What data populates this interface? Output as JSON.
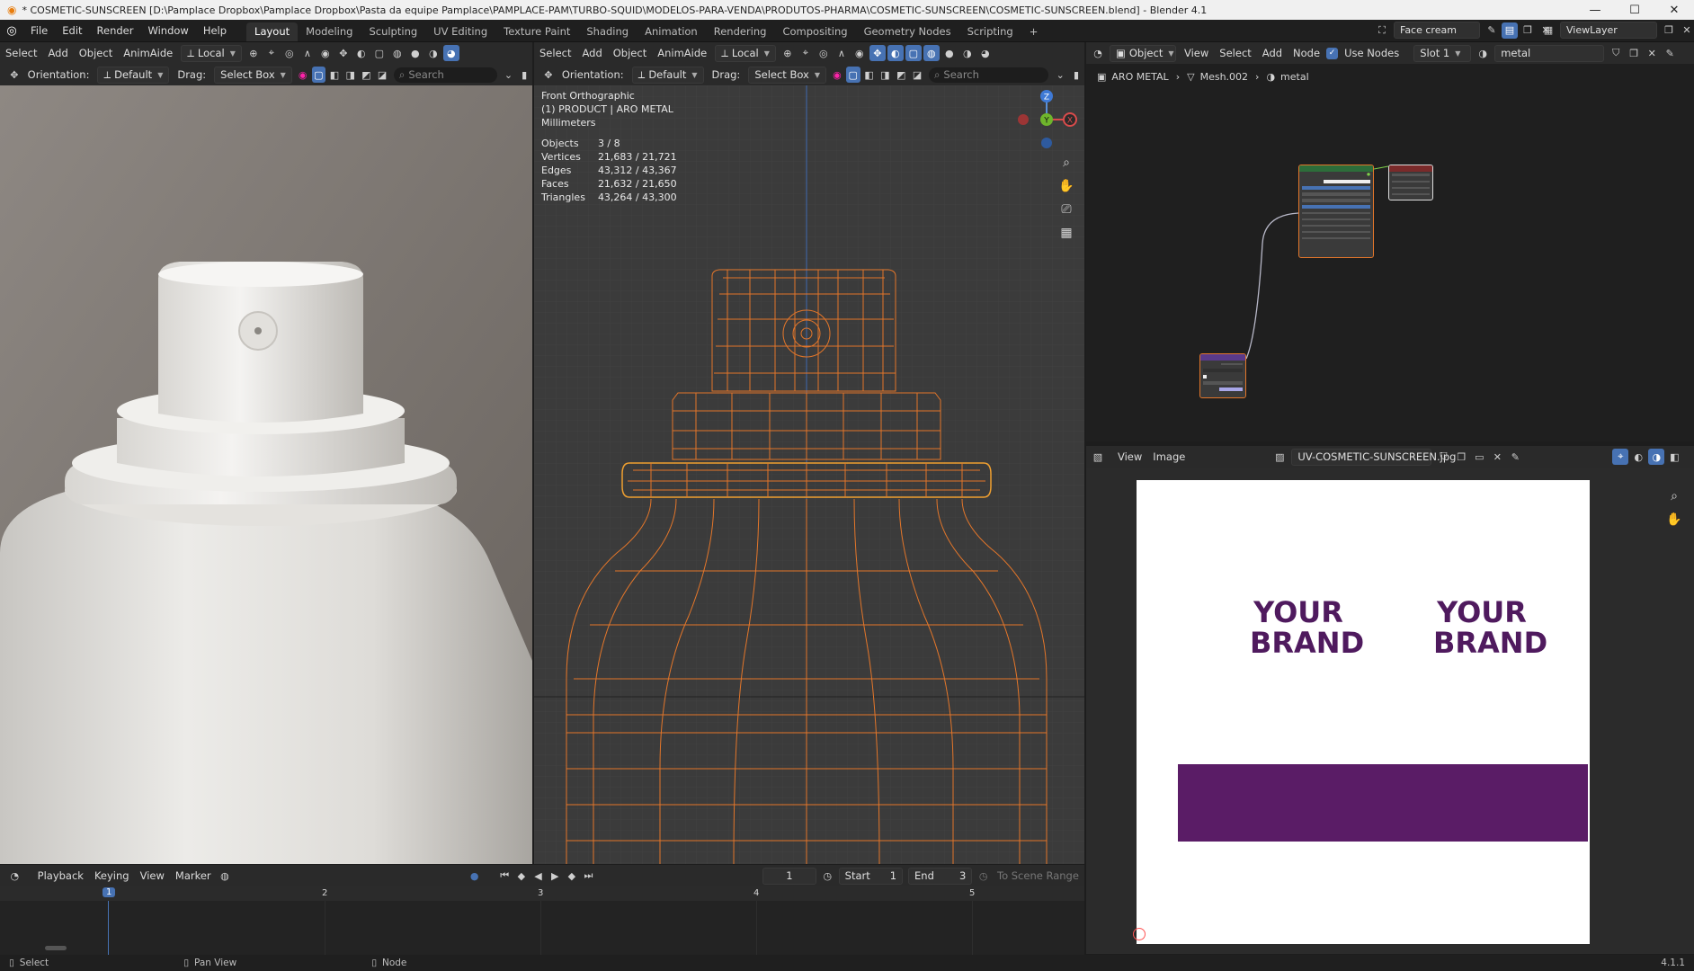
{
  "window": {
    "title": "* COSMETIC-SUNSCREEN [D:\\Pamplace Dropbox\\Pamplace Dropbox\\Pasta da equipe Pamplace\\PAMPLACE-PAM\\TURBO-SQUID\\MODELOS-PARA-VENDA\\PRODUTOS-PHARMA\\COSMETIC-SUNSCREEN\\COSMETIC-SUNSCREEN.blend] - Blender 4.1",
    "minimize": "—",
    "maximize": "☐",
    "close": "✕"
  },
  "menu": [
    "File",
    "Edit",
    "Render",
    "Window",
    "Help"
  ],
  "workspaces": [
    "Layout",
    "Modeling",
    "Sculpting",
    "UV Editing",
    "Texture Paint",
    "Shading",
    "Animation",
    "Rendering",
    "Compositing",
    "Geometry Nodes",
    "Scripting"
  ],
  "active_workspace": "Layout",
  "top_right": {
    "scene_name": "Face cream",
    "view_layer": "ViewLayer"
  },
  "left_viewport": {
    "header_menu": [
      "Select",
      "Add",
      "Object",
      "AnimAide"
    ],
    "transform_orientation": "Local",
    "orientation_label": "Orientation:",
    "orientation_value": "Default",
    "drag_label": "Drag:",
    "drag_value": "Select Box",
    "search_placeholder": "Search"
  },
  "center_viewport": {
    "header_menu": [
      "Select",
      "Add",
      "Object",
      "AnimAide"
    ],
    "transform_orientation": "Local",
    "orientation_label": "Orientation:",
    "orientation_value": "Default",
    "drag_label": "Drag:",
    "drag_value": "Select Box",
    "search_placeholder": "Search",
    "view_name": "Front Orthographic",
    "collection_info": "(1) PRODUCT | ARO METAL",
    "units": "Millimeters",
    "stats": [
      {
        "label": "Objects",
        "value": "3 / 8"
      },
      {
        "label": "Vertices",
        "value": "21,683 / 21,721"
      },
      {
        "label": "Edges",
        "value": "43,312 / 43,367"
      },
      {
        "label": "Faces",
        "value": "21,632 / 21,650"
      },
      {
        "label": "Triangles",
        "value": "43,264 / 43,300"
      }
    ],
    "gizmo": {
      "z": "Z",
      "y": "Y",
      "x": "X"
    }
  },
  "node_editor": {
    "object_mode": "Object",
    "menu": [
      "View",
      "Select",
      "Add",
      "Node"
    ],
    "use_nodes_label": "Use Nodes",
    "slot": "Slot 1",
    "material": "metal",
    "breadcrumb": [
      "ARO METAL",
      "Mesh.002",
      "metal"
    ]
  },
  "image_editor": {
    "menu": [
      "View",
      "Image"
    ],
    "image_name": "UV-COSMETIC-SUNSCREEN.jpg",
    "brand_text_line1": "YOUR",
    "brand_text_line2": "BRAND",
    "brand_color": "#4f1a5e"
  },
  "timeline": {
    "menu": [
      "Playback",
      "Keying",
      "View",
      "Marker"
    ],
    "current_frame": "1",
    "start_label": "Start",
    "start": "1",
    "end_label": "End",
    "end": "3",
    "to_scene_range": "To Scene Range",
    "ruler": [
      "1",
      "2",
      "3",
      "4",
      "5"
    ]
  },
  "statusbar": {
    "select": "Select",
    "pan_view": "Pan View",
    "node": "Node",
    "version": "4.1.1"
  },
  "colors": {
    "accent": "#4772b3",
    "wire_orange": "#e3762a"
  }
}
